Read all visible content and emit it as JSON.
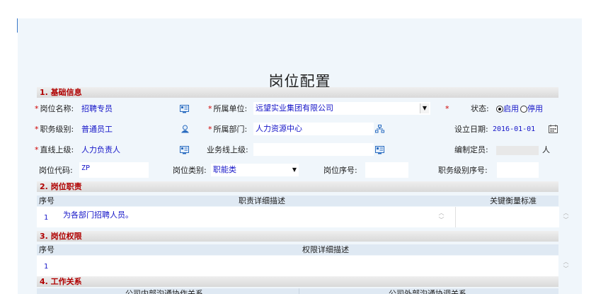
{
  "page_title": "岗位配置",
  "sections": {
    "basic": "1. 基础信息",
    "duty": "2. 岗位职责",
    "authority": "3. 岗位权限",
    "work": "4. 工作关系"
  },
  "basic": {
    "required_mark": "*",
    "position_name": {
      "label": "岗位名称:",
      "value": "招聘专员"
    },
    "unit": {
      "label": "所属单位:",
      "value": "远望实业集团有限公司"
    },
    "status": {
      "label": "状态:",
      "options": [
        "启用",
        "停用"
      ],
      "selected": "启用"
    },
    "job_level": {
      "label": "职务级别:",
      "value": "普通员工"
    },
    "department": {
      "label": "所属部门:",
      "value": "人力资源中心"
    },
    "setup_date": {
      "label": "设立日期:",
      "value": "2016-01-01"
    },
    "superior": {
      "label": "直线上级:",
      "value": "人力负责人"
    },
    "business_superior": {
      "label": "业务线上级:",
      "value": ""
    },
    "headcount": {
      "label": "编制定员:",
      "value": "",
      "unit": "人"
    },
    "position_code": {
      "label": "岗位代码:",
      "value": "ZP"
    },
    "position_type": {
      "label": "岗位类别:",
      "value": "职能类"
    },
    "position_seq": {
      "label": "岗位序号:",
      "value": ""
    },
    "level_seq": {
      "label": "职务级别序号:",
      "value": ""
    }
  },
  "duty_table": {
    "headers": [
      "序号",
      "职责详细描述",
      "关键衡量标准"
    ],
    "rows": [
      {
        "no": "1",
        "desc": "为各部门招聘人员。",
        "standard": ""
      }
    ]
  },
  "authority_table": {
    "headers": [
      "序号",
      "权限详细描述"
    ],
    "rows": [
      {
        "no": "1",
        "desc": ""
      }
    ]
  },
  "work_table": {
    "headers": [
      "公司内部沟通协作关系",
      "公司外部沟通协调关系"
    ]
  },
  "icons": {
    "picker": "contact-card-icon",
    "person": "person-icon",
    "org": "org-chart-icon",
    "calendar": "calendar-icon"
  }
}
